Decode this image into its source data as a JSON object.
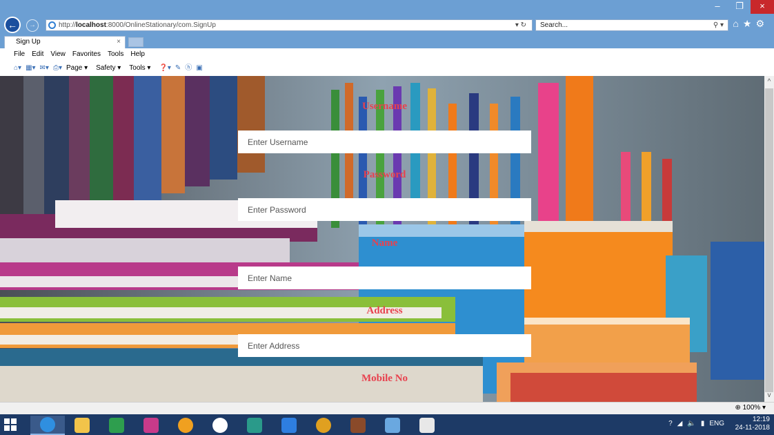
{
  "window": {
    "minimize": "–",
    "restore": "❐",
    "close": "×"
  },
  "address": {
    "url_prefix": "http://",
    "url_host": "localhost",
    "url_rest": ":8000/OnlineStationary/com.SignUp",
    "tools": "▾ ↻"
  },
  "search": {
    "placeholder": "Search..."
  },
  "tab": {
    "title": "Sign Up",
    "close": "×"
  },
  "menubar": {
    "items": [
      "File",
      "Edit",
      "View",
      "Favorites",
      "Tools",
      "Help"
    ]
  },
  "commandbar": {
    "items": [
      "Page ▾",
      "Safety ▾",
      "Tools ▾"
    ]
  },
  "form": {
    "username": {
      "label": "Username",
      "placeholder": "Enter Username"
    },
    "password": {
      "label": "Password",
      "placeholder": "Enter Password"
    },
    "name": {
      "label": "Name",
      "placeholder": "Enter Name"
    },
    "address": {
      "label": "Address",
      "placeholder": "Enter Address"
    },
    "mobile": {
      "label": "Mobile No"
    }
  },
  "status": {
    "zoom": "100%"
  },
  "taskbar": {
    "lang": "ENG",
    "time": "12:19",
    "date": "24-11-2018"
  },
  "colors": {
    "label_red": "#e8414e",
    "ie_frame": "#6c9fd3",
    "taskbar": "#1d3a66"
  }
}
